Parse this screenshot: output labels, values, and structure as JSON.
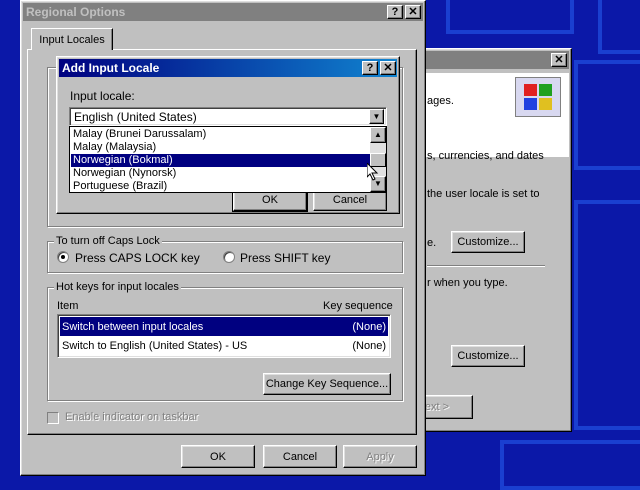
{
  "regional_options": {
    "title": "Regional Options",
    "tab": "Input Locales",
    "caps_group": "To turn off Caps Lock",
    "caps_option_1": "Press CAPS LOCK key",
    "caps_option_2": "Press SHIFT key",
    "hotkeys_group": "Hot keys for input locales",
    "col_item": "Item",
    "col_key": "Key sequence",
    "hotkeys": [
      {
        "item": "Switch between input locales",
        "key": "(None)"
      },
      {
        "item": "Switch to English (United States) - US",
        "key": "(None)"
      }
    ],
    "change_key_button": "Change Key Sequence...",
    "enable_indicator": "Enable indicator on taskbar",
    "ok": "OK",
    "cancel": "Cancel",
    "apply": "Apply"
  },
  "add_locale": {
    "title": "Add Input Locale",
    "input_locale_label": "Input locale:",
    "selected": "English (United States)",
    "options": [
      "Malay (Brunei Darussalam)",
      "Malay (Malaysia)",
      "Norwegian (Bokmal)",
      "Norwegian (Nynorsk)",
      "Portuguese (Brazil)"
    ],
    "highlighted_option": "Norwegian (Bokmal)",
    "ok": "OK",
    "cancel": "Cancel"
  },
  "background_window": {
    "text_1": "ages.",
    "text_2": "s, currencies, and dates",
    "text_3": "the user locale is set to",
    "text_4": "e.",
    "text_5": "r when you type.",
    "customize_1": "Customize...",
    "customize_2": "Customize...",
    "next_button": "ext >"
  },
  "colors": {
    "desktop": "#0b18a8",
    "title_active": "#000080",
    "title_inactive": "#808080",
    "selection": "#000080"
  }
}
